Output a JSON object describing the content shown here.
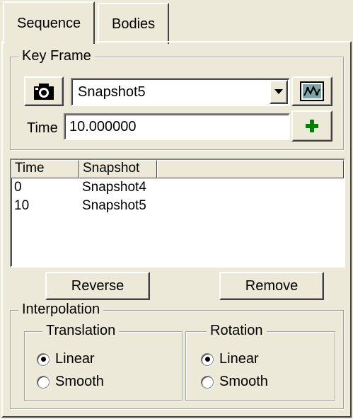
{
  "tabs": [
    {
      "label": "Sequence",
      "active": true
    },
    {
      "label": "Bodies",
      "active": false
    }
  ],
  "key_frame": {
    "legend": "Key Frame",
    "snapshot_selected": "Snapshot5",
    "time_label": "Time",
    "time_value": "10.000000",
    "icons": {
      "snapshot": "camera-icon",
      "view": "view-snapshot-icon",
      "add": "add-plus-icon"
    }
  },
  "table": {
    "columns": [
      "Time",
      "Snapshot",
      ""
    ],
    "rows": [
      {
        "time": "0",
        "snapshot": "Snapshot4"
      },
      {
        "time": "10",
        "snapshot": "Snapshot5"
      }
    ]
  },
  "actions": {
    "reverse": "Reverse",
    "remove": "Remove"
  },
  "interpolation": {
    "legend": "Interpolation",
    "translation": {
      "legend": "Translation",
      "options": [
        "Linear",
        "Smooth"
      ],
      "selected": "Linear"
    },
    "rotation": {
      "legend": "Rotation",
      "options": [
        "Linear",
        "Smooth"
      ],
      "selected": "Linear"
    }
  },
  "colors": {
    "face": "#ece9d8",
    "plus": "#008000"
  }
}
